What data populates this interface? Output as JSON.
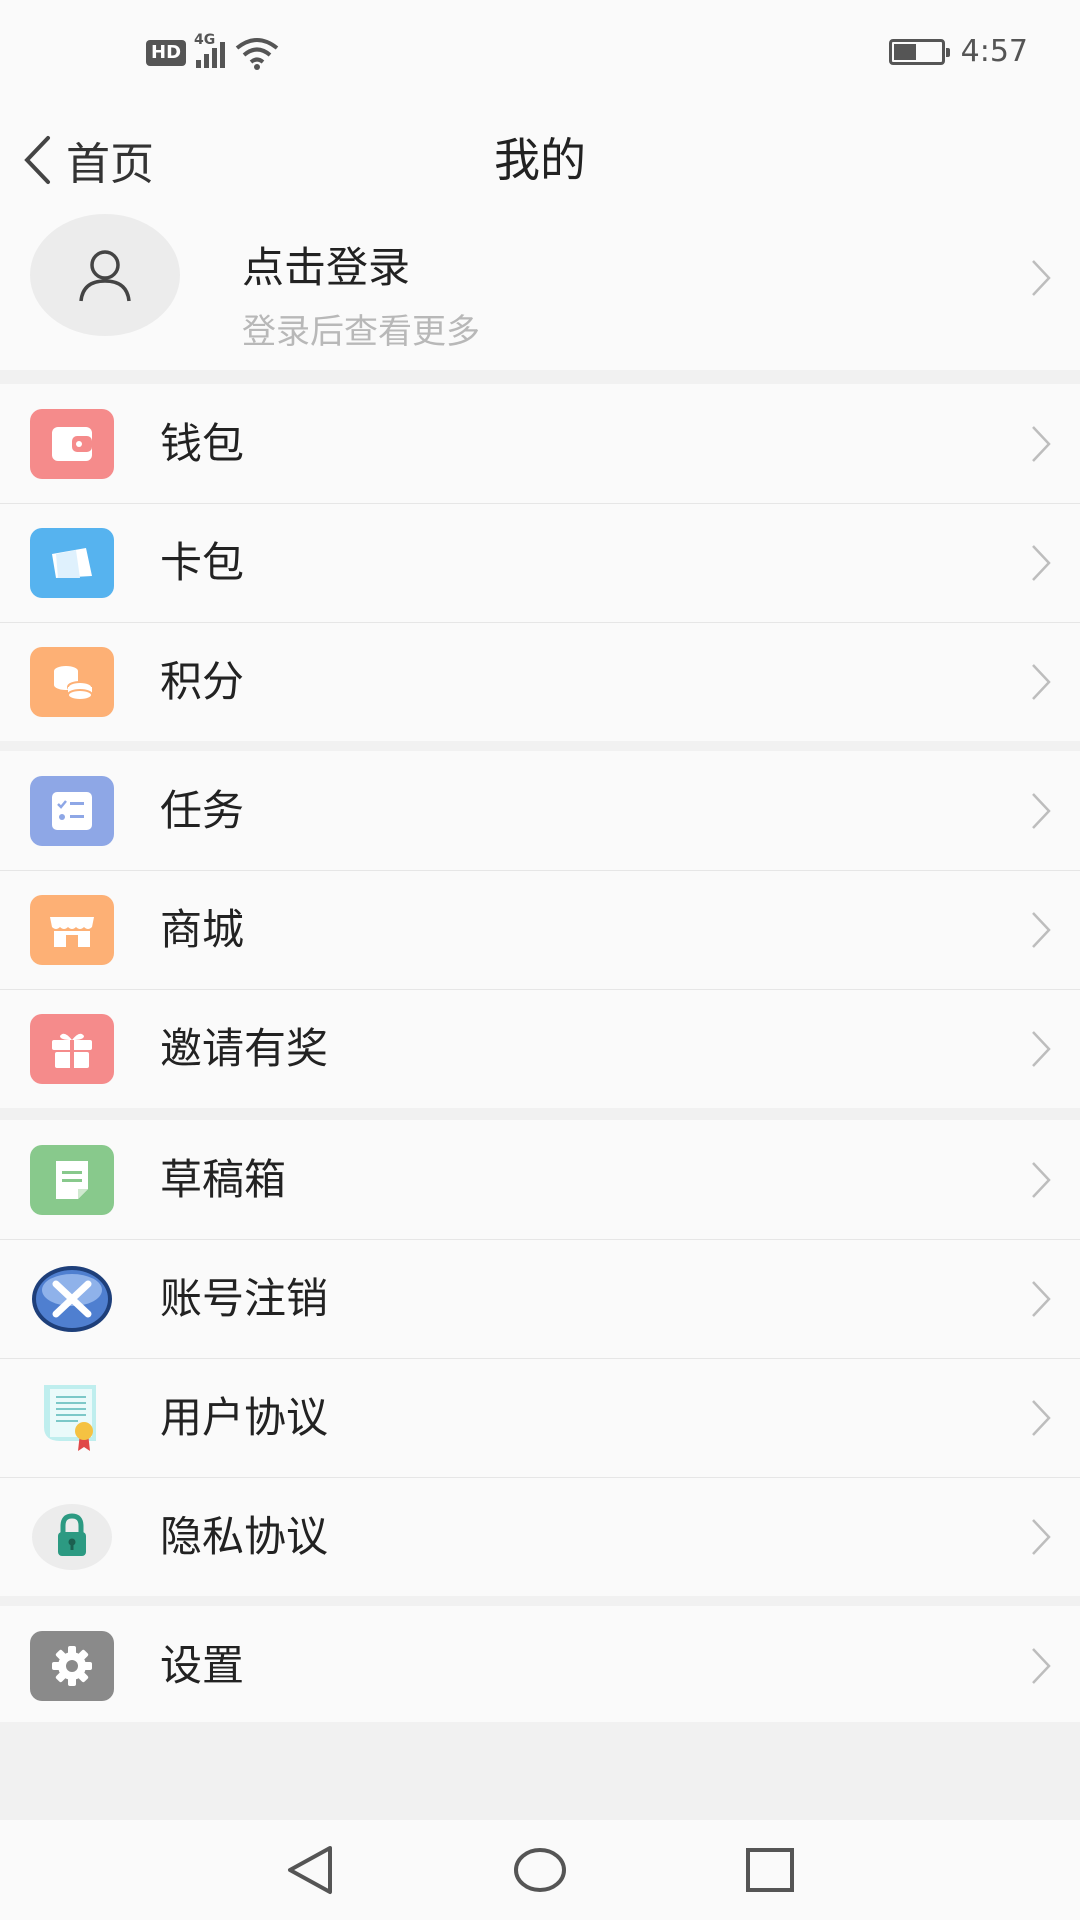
{
  "status_bar": {
    "hd": "HD",
    "network": "4G",
    "time": "4:57",
    "battery_level": 0.45
  },
  "header": {
    "back_label": "首页",
    "title": "我的"
  },
  "profile": {
    "login_title": "点击登录",
    "login_subtitle": "登录后查看更多"
  },
  "menu": {
    "wallet": {
      "label": "钱包",
      "icon": "wallet-icon",
      "color": "#f58b8b"
    },
    "cards": {
      "label": "卡包",
      "icon": "card-icon",
      "color": "#56b3ef"
    },
    "points": {
      "label": "积分",
      "icon": "coins-icon",
      "color": "#fdb075"
    },
    "tasks": {
      "label": "任务",
      "icon": "task-list-icon",
      "color": "#8ea7e6"
    },
    "mall": {
      "label": "商城",
      "icon": "store-icon",
      "color": "#fdb075"
    },
    "invite": {
      "label": "邀请有奖",
      "icon": "gift-icon",
      "color": "#f58b8b"
    },
    "drafts": {
      "label": "草稿箱",
      "icon": "draft-note-icon",
      "color": "#88c98c"
    },
    "delete_account": {
      "label": "账号注销",
      "icon": "x-circle-icon",
      "color": "#4f7fd0"
    },
    "user_agreement": {
      "label": "用户协议",
      "icon": "certificate-icon",
      "color": "#7fd7d3"
    },
    "privacy_agreement": {
      "label": "隐私协议",
      "icon": "lock-icon",
      "color": "#2c9a82"
    },
    "settings": {
      "label": "设置",
      "icon": "gear-icon",
      "color": "#8a8a8a"
    }
  }
}
